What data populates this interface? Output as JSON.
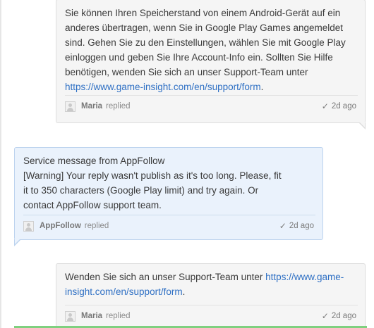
{
  "thread": {
    "message1": {
      "text": "Sie können Ihren Speicherstand von einem Android-Gerät auf ein anderes übertragen, wenn Sie in Google Play Games angemeldet sind. Gehen Sie zu den Einstellungen, wählen Sie mit Google Play einloggen und geben Sie Ihre Account-Info ein. Sollten Sie Hilfe benötigen, wenden Sie sich an unser Support-Team unter ",
      "link": "https://www.game-insight.com/en/support/form",
      "after": ".",
      "author": "Maria",
      "verb": "replied",
      "time": "2d ago"
    },
    "message2": {
      "line1": "Service message from AppFollow",
      "text": "[Warning] Your reply wasn't publish as it's too long. Please, fit it to 350 characters (Google Play limit) and try again. Or contact AppFollow support team.",
      "author": "AppFollow",
      "verb": "replied",
      "time": "2d ago"
    },
    "message3": {
      "text": "Wenden Sie sich an unser Support-Team unter ",
      "link": "https://www.game-insight.com/en/support/form",
      "after": ".",
      "author": "Maria",
      "verb": "replied",
      "time": "2d ago"
    }
  }
}
